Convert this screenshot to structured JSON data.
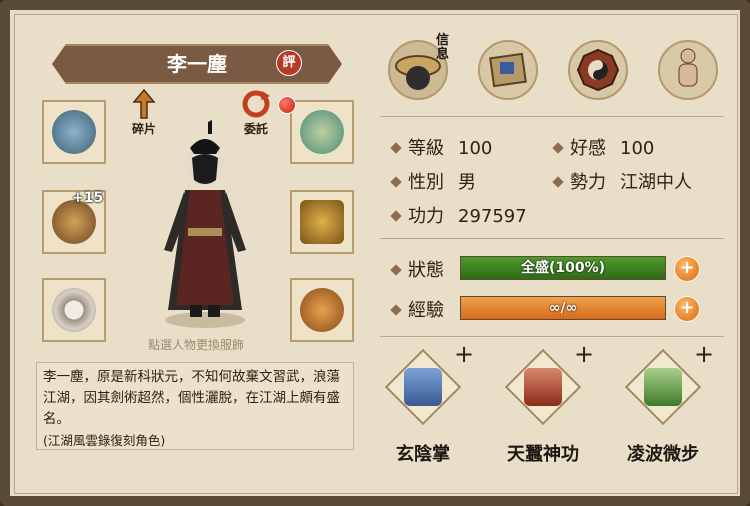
{
  "character": {
    "name": "李一塵",
    "badge": "評",
    "hint": "點選人物更換服飾",
    "description": "李一塵，原是新科狀元，不知何故棄文習武，浪蕩江湖，因其劍術超然，個性灑脫，在江湖上頗有盛名。",
    "note": "(江湖風雲錄復刻角色)"
  },
  "icons": {
    "fragment_label": "碎片",
    "entrust_label": "委託",
    "bracelet_bonus": "+15"
  },
  "tabs": {
    "active_label": "信息"
  },
  "stats": {
    "level_label": "等級",
    "level": "100",
    "favor_label": "好感",
    "favor": "100",
    "gender_label": "性別",
    "gender": "男",
    "faction_label": "勢力",
    "faction": "江湖中人",
    "power_label": "功力",
    "power": "297597"
  },
  "status": {
    "label": "狀態",
    "text": "全盛(100%)",
    "fill": 1.0,
    "color": "#4f9b2c"
  },
  "exp": {
    "label": "經驗",
    "text": "∞/∞",
    "fill": 1.0,
    "color": "#d86a18"
  },
  "skills": [
    {
      "name": "玄陰掌",
      "plus": "+"
    },
    {
      "name": "天蠶神功",
      "plus": "+"
    },
    {
      "name": "凌波微步",
      "plus": "+"
    }
  ]
}
